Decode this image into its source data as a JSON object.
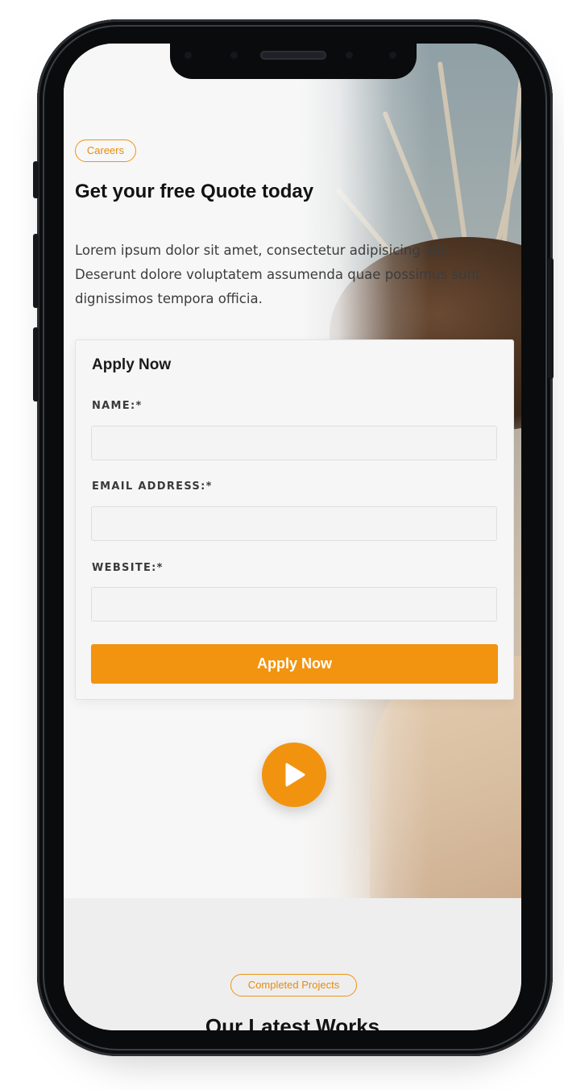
{
  "hero": {
    "badge": "Careers",
    "title": "Get your free Quote today",
    "description": "Lorem ipsum dolor sit amet, consectetur adipisicing elit. Deserunt dolore voluptatem assumenda quae possimus sunt dignissimos tempora officia."
  },
  "form": {
    "title": "Apply Now",
    "name_label": "NAME:*",
    "name_value": "",
    "email_label": "EMAIL ADDRESS:*",
    "email_value": "",
    "website_label": "WEBSITE:*",
    "website_value": "",
    "submit_label": "Apply Now"
  },
  "video": {
    "icon": "play-icon"
  },
  "projects": {
    "badge": "Completed Projects",
    "title": "Our Latest Works"
  },
  "colors": {
    "accent": "#f2940f",
    "text_dark": "#121212",
    "page_bg": "#f7f7f7"
  }
}
